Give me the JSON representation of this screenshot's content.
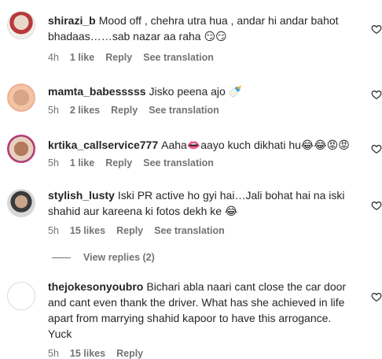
{
  "comments": [
    {
      "username": "shirazi_b",
      "text": "Mood off , chehra utra hua , andar hi andar bahot bhadaas……sab nazar aa raha 😏😏",
      "time": "4h",
      "likes": "1 like",
      "reply": "Reply",
      "translate": "See translation"
    },
    {
      "username": "mamta_babesssss",
      "text": "Jisko peena ajo 🍼",
      "time": "5h",
      "likes": "2 likes",
      "reply": "Reply",
      "translate": "See translation"
    },
    {
      "username": "krtika_callservice777",
      "text": "Aaha👄aayo kuch dikhati hu😂😂😡😡",
      "time": "5h",
      "likes": "1 like",
      "reply": "Reply",
      "translate": "See translation"
    },
    {
      "username": "stylish_lusty",
      "text": "Iski PR active ho gyi hai…Jali bohat hai na iski shahid aur kareena ki fotos dekh ke 😂",
      "time": "5h",
      "likes": "15 likes",
      "reply": "Reply",
      "translate": "See translation"
    },
    {
      "username": "thejokesonyoubro",
      "text": "Bichari abla naari cant close the car door and cant even thank the driver. What has she achieved in life apart from marrying shahid kapoor to have this arrogance. Yuck",
      "time": "5h",
      "likes": "15 likes",
      "reply": "Reply",
      "translate": ""
    }
  ],
  "view_replies": "View replies (2)",
  "icons": {
    "like": "heart-outline-icon"
  }
}
